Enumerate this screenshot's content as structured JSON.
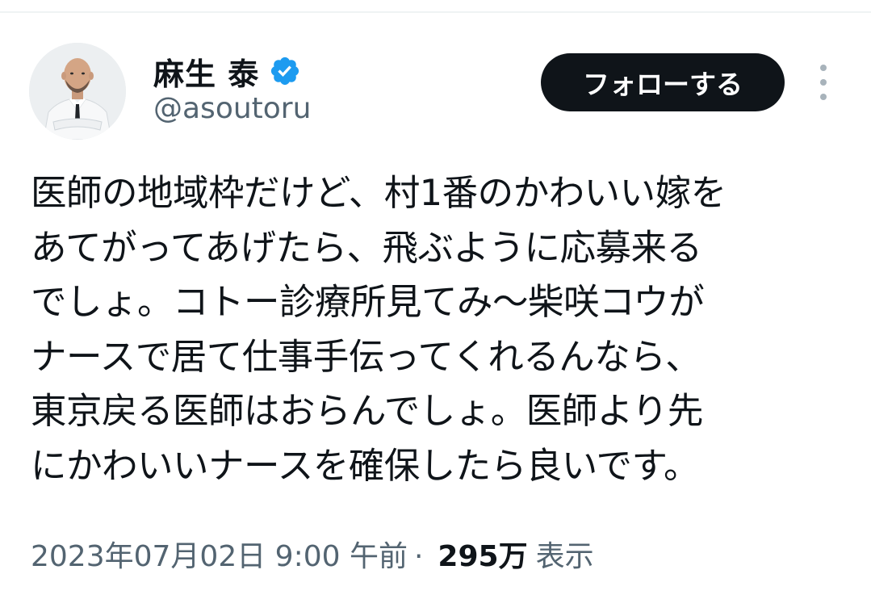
{
  "profile": {
    "display_name": "麻生 泰",
    "handle": "@asoutoru",
    "verified": true
  },
  "actions": {
    "follow_label": "フォローする"
  },
  "tweet": {
    "lines": [
      "医師の地域枠だけど、村1番のかわいい嫁を",
      "あてがってあげたら、飛ぶように応募来る",
      "でしょ。コトー診療所見てみ〜柴咲コウが",
      "ナースで居て仕事手伝ってくれるんなら、",
      "東京戻る医師はおらんでしょ。医師より先",
      "にかわいいナースを確保したら良いです。"
    ],
    "timestamp": "2023年07月02日 9:00 午前",
    "separator": "·",
    "views_count": "295万",
    "views_label": "表示"
  },
  "colors": {
    "text_primary": "#0f1419",
    "text_secondary": "#536471",
    "verified_blue": "#1d9bf0",
    "button_bg": "#0f1419"
  },
  "icons": {
    "verified": "verified-badge-icon",
    "more": "more-vertical-icon"
  }
}
